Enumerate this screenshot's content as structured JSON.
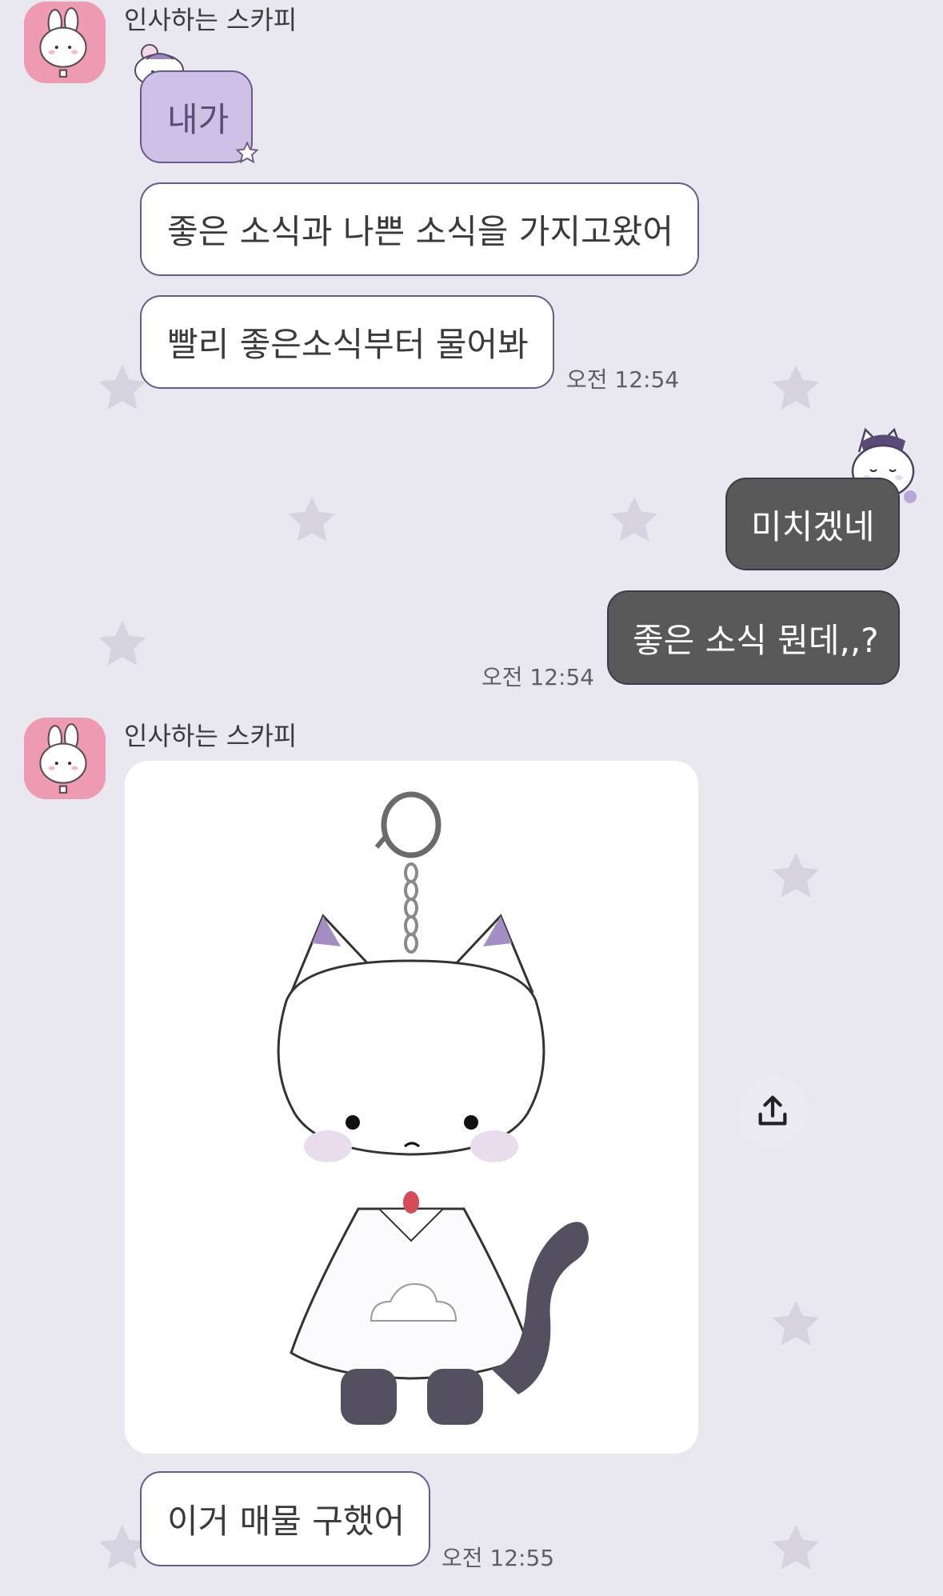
{
  "messages": [
    {
      "sender": "인사하는 스카피",
      "bubbles": [
        "내가",
        "좋은 소식과 나쁜 소식을 가지고왔어",
        "빨리 좋은소식부터 물어봐"
      ],
      "time": "오전 12:54"
    },
    {
      "sender": "me",
      "bubbles": [
        "미치겠네",
        "좋은 소식 뭔데,,?"
      ],
      "time": "오전 12:54"
    },
    {
      "sender": "인사하는 스카피",
      "attachment": "cat-keychain-photo",
      "bubbles": [
        "이거 매물 구했어"
      ],
      "time": "오전 12:55"
    }
  ],
  "icons": {
    "avatar": "bunny-avatar-icon",
    "share": "share-icon",
    "background": "star-icon"
  },
  "colors": {
    "background": "#e9e7ef",
    "incoming_bubble": "#ffffff",
    "incoming_border": "#6a5a88",
    "outgoing_bubble": "#595959",
    "sticker_bubble": "#cfc1e6"
  }
}
